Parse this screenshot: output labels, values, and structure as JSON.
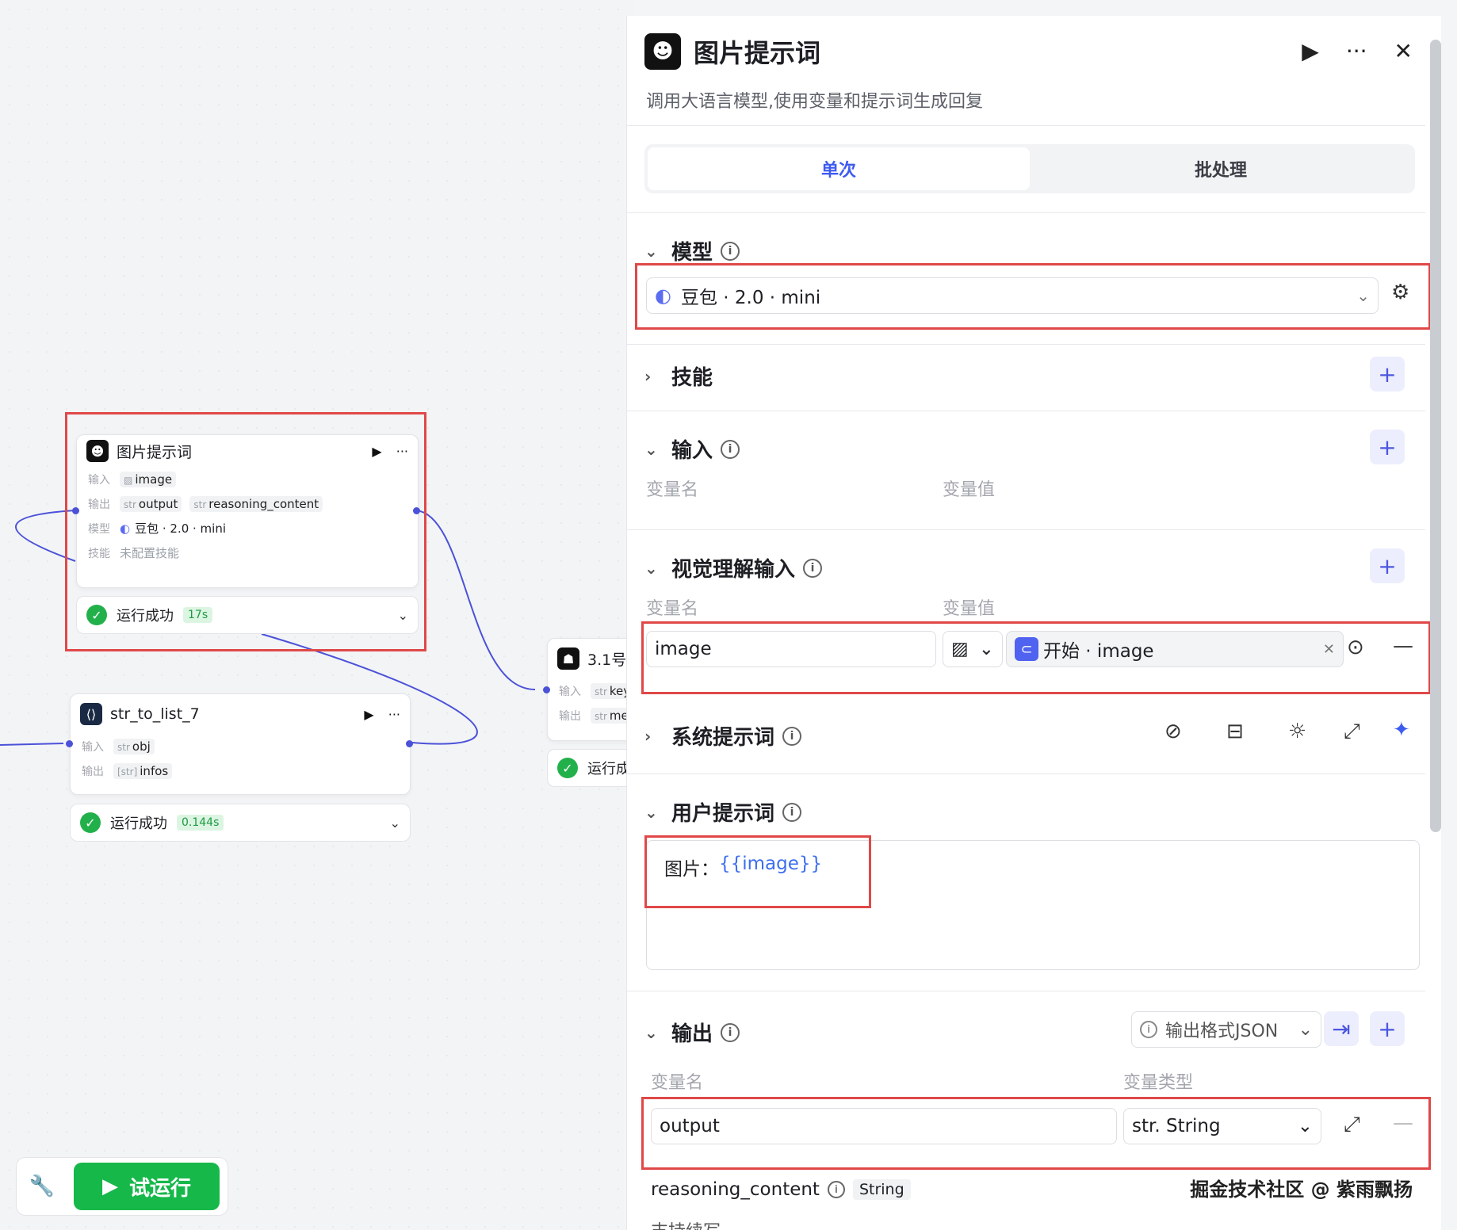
{
  "canvas": {
    "node1": {
      "title": "图片提示词",
      "input_key": "输入",
      "input_val": "image",
      "output_key": "输出",
      "output_vals": [
        "output",
        "reasoning_content"
      ],
      "output_type": "str",
      "model_key": "模型",
      "model_val": "豆包 · 2.0 · mini",
      "skill_key": "技能",
      "skill_val": "未配置技能",
      "status": "运行成功",
      "time": "17s"
    },
    "node2": {
      "title": "str_to_list_7",
      "input_key": "输入",
      "input_val": "obj",
      "input_type": "str",
      "output_key": "输出",
      "output_val": "infos",
      "output_type": "[str]",
      "status": "运行成功",
      "time": "0.144s"
    },
    "node3": {
      "title": "3.1号",
      "input_key": "输入",
      "input_val": "key",
      "output_key": "输出",
      "output_val": "me",
      "status": "运行成"
    },
    "run_button": "试运行"
  },
  "panel": {
    "title": "图片提示词",
    "description": "调用大语言模型,使用变量和提示词生成回复",
    "tabs": [
      "单次",
      "批处理"
    ],
    "model_section": "模型",
    "model_value": "豆包 · 2.0 · mini",
    "skills_section": "技能",
    "input_section": "输入",
    "col_var_name": "变量名",
    "col_var_value": "变量值",
    "vision_section": "视觉理解输入",
    "vision_var_name": "image",
    "vision_ref": "开始 · image",
    "system_prompt_section": "系统提示词",
    "user_prompt_section": "用户提示词",
    "user_prompt_label": "图片：",
    "user_prompt_var": "{{image}}",
    "output_section": "输出",
    "output_format": "输出格式JSON",
    "col_var_type": "变量类型",
    "output_var_name": "output",
    "output_var_type": "str. String",
    "reasoning_name": "reasoning_content",
    "reasoning_type": "String",
    "stream_label": "支持续写",
    "watermark": "掘金技术社区 @ 紫雨飘扬"
  }
}
